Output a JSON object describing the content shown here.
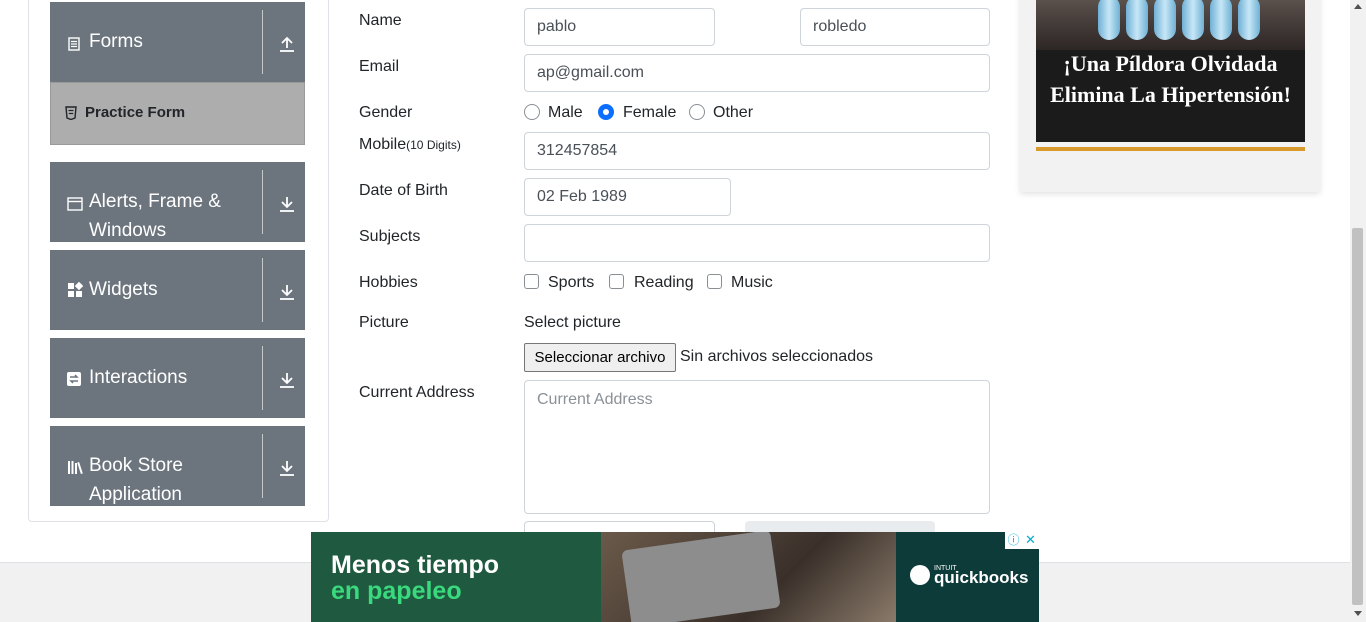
{
  "sidebar": {
    "groups": [
      {
        "label": "Forms",
        "icon": "document-icon",
        "arrow": "arrow-up-icon"
      },
      {
        "label": "Alerts, Frame &",
        "label2": "Windows",
        "icon": "window-icon",
        "arrow": "arrow-down-icon"
      },
      {
        "label": "Widgets",
        "icon": "grid-icon",
        "arrow": "arrow-down-icon"
      },
      {
        "label": "Interactions",
        "icon": "swap-icon",
        "arrow": "arrow-down-icon"
      },
      {
        "label": "Book Store",
        "label2": "Application",
        "icon": "books-icon",
        "arrow": "arrow-down-icon"
      }
    ],
    "submenu": {
      "label": "Practice Form",
      "icon": "html5-icon"
    }
  },
  "form": {
    "name_label": "Name",
    "first_name": "pablo",
    "last_name": "robledo",
    "email_label": "Email",
    "email": "ap@gmail.com",
    "gender_label": "Gender",
    "gender_options": [
      "Male",
      "Female",
      "Other"
    ],
    "gender_selected": "Female",
    "mobile_label": "Mobile",
    "mobile_hint": "(10 Digits)",
    "mobile": "312457854",
    "dob_label": "Date of Birth",
    "dob": "02 Feb 1989",
    "subjects_label": "Subjects",
    "subjects": "",
    "hobbies_label": "Hobbies",
    "hobbies": [
      "Sports",
      "Reading",
      "Music"
    ],
    "picture_label": "Picture",
    "picture_prompt": "Select picture",
    "file_button": "Seleccionar archivo",
    "file_status": "Sin archivos seleccionados",
    "address_label": "Current Address",
    "address_placeholder": "Current Address"
  },
  "ads": {
    "right_text": "¡Una Píldora Olvidada Elimina La Hipertensión!",
    "bottom_line1": "Menos tiempo",
    "bottom_line2": "en papeleo",
    "bottom_brand": "quickbooks",
    "bottom_brand_prefix": "INTUIT",
    "info_glyph": "ⓘ",
    "close_glyph": "✕"
  },
  "colors": {
    "sidebar_group": "#6c757d",
    "submenu_active": "#adadad",
    "accent": "#0d6efd",
    "ad_green": "#3ad97d"
  }
}
